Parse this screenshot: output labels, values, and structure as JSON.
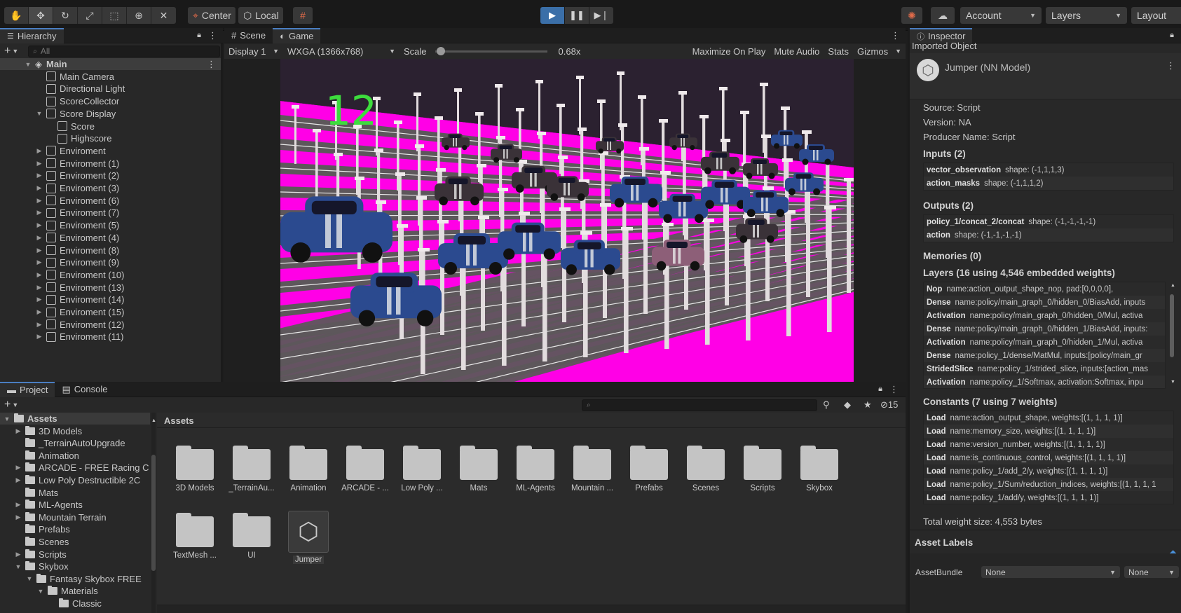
{
  "toolbar": {
    "pivot": "Center",
    "space": "Local",
    "account": "Account",
    "layers": "Layers",
    "layout": "Layout"
  },
  "hierarchy": {
    "tab": "Hierarchy",
    "search_placeholder": "All",
    "items": [
      {
        "label": "Main"
      },
      {
        "label": "Main Camera"
      },
      {
        "label": "Directional Light"
      },
      {
        "label": "ScoreCollector"
      },
      {
        "label": "Score Display"
      },
      {
        "label": "Score"
      },
      {
        "label": "Highscore"
      },
      {
        "label": "Enviroment"
      },
      {
        "label": "Enviroment (1)"
      },
      {
        "label": "Enviroment (2)"
      },
      {
        "label": "Enviroment (3)"
      },
      {
        "label": "Enviroment (6)"
      },
      {
        "label": "Enviroment (7)"
      },
      {
        "label": "Enviroment (5)"
      },
      {
        "label": "Enviroment (4)"
      },
      {
        "label": "Enviroment (8)"
      },
      {
        "label": "Enviroment (9)"
      },
      {
        "label": "Enviroment (10)"
      },
      {
        "label": "Enviroment (13)"
      },
      {
        "label": "Enviroment (14)"
      },
      {
        "label": "Enviroment (15)"
      },
      {
        "label": "Enviroment (12)"
      },
      {
        "label": "Enviroment (11)"
      }
    ]
  },
  "view_tabs": {
    "scene": "Scene",
    "game": "Game"
  },
  "game_toolbar": {
    "display": "Display 1",
    "resolution": "WXGA (1366x768)",
    "scale_label": "Scale",
    "scale_value": "0.68x",
    "scale_level": 0.05,
    "maximize": "Maximize On Play",
    "mute": "Mute Audio",
    "stats": "Stats",
    "gizmos": "Gizmos"
  },
  "game": {
    "score": "12"
  },
  "project": {
    "tab_project": "Project",
    "tab_console": "Console",
    "hidden_count": "15",
    "breadcrumb": "Assets",
    "tree": [
      {
        "label": "Assets"
      },
      {
        "label": "3D Models"
      },
      {
        "label": "_TerrainAutoUpgrade"
      },
      {
        "label": "Animation"
      },
      {
        "label": "ARCADE - FREE Racing C"
      },
      {
        "label": "Low Poly Destructible 2C"
      },
      {
        "label": "Mats"
      },
      {
        "label": "ML-Agents"
      },
      {
        "label": "Mountain Terrain"
      },
      {
        "label": "Prefabs"
      },
      {
        "label": "Scenes"
      },
      {
        "label": "Scripts"
      },
      {
        "label": "Skybox"
      },
      {
        "label": "Fantasy Skybox FREE"
      },
      {
        "label": "Materials"
      },
      {
        "label": "Classic"
      }
    ],
    "assets": [
      {
        "label": "3D Models"
      },
      {
        "label": "_TerrainAu..."
      },
      {
        "label": "Animation"
      },
      {
        "label": "ARCADE - ..."
      },
      {
        "label": "Low Poly ..."
      },
      {
        "label": "Mats"
      },
      {
        "label": "ML-Agents"
      },
      {
        "label": "Mountain ..."
      },
      {
        "label": "Prefabs"
      },
      {
        "label": "Scenes"
      },
      {
        "label": "Scripts"
      },
      {
        "label": "Skybox"
      },
      {
        "label": "TextMesh ..."
      },
      {
        "label": "UI"
      },
      {
        "label": "Jumper"
      }
    ]
  },
  "inspector": {
    "tab": "Inspector",
    "subtitle": "Imported Object",
    "object_name": "Jumper (NN Model)",
    "source": "Source: Script",
    "version": "Version: NA",
    "producer": "Producer Name: Script",
    "inputs_title": "Inputs (2)",
    "inputs": [
      {
        "name": "vector_observation",
        "detail": "shape: (-1,1,1,3)"
      },
      {
        "name": "action_masks",
        "detail": "shape: (-1,1,1,2)"
      }
    ],
    "outputs_title": "Outputs (2)",
    "outputs": [
      {
        "name": "policy_1/concat_2/concat",
        "detail": "shape: (-1,-1,-1,-1)"
      },
      {
        "name": "action",
        "detail": "shape: (-1,-1,-1,-1)"
      }
    ],
    "memories_title": "Memories (0)",
    "layers_title": "Layers (16 using 4,546 embedded weights)",
    "layers": [
      {
        "name": "Nop",
        "detail": "name:action_output_shape_nop, pad:[0,0,0,0],"
      },
      {
        "name": "Dense",
        "detail": "name:policy/main_graph_0/hidden_0/BiasAdd, inputs"
      },
      {
        "name": "Activation",
        "detail": "name:policy/main_graph_0/hidden_0/Mul, activa"
      },
      {
        "name": "Dense",
        "detail": "name:policy/main_graph_0/hidden_1/BiasAdd, inputs:"
      },
      {
        "name": "Activation",
        "detail": "name:policy/main_graph_0/hidden_1/Mul, activa"
      },
      {
        "name": "Dense",
        "detail": "name:policy_1/dense/MatMul, inputs:[policy/main_gr"
      },
      {
        "name": "StridedSlice",
        "detail": "name:policy_1/strided_slice, inputs:[action_mas"
      },
      {
        "name": "Activation",
        "detail": "name:policy_1/Softmax, activation:Softmax, inpu"
      }
    ],
    "constants_title": "Constants (7 using 7 weights)",
    "constants": [
      {
        "name": "Load",
        "detail": "name:action_output_shape, weights:[(1, 1, 1, 1)]"
      },
      {
        "name": "Load",
        "detail": "name:memory_size, weights:[(1, 1, 1, 1)]"
      },
      {
        "name": "Load",
        "detail": "name:version_number, weights:[(1, 1, 1, 1)]"
      },
      {
        "name": "Load",
        "detail": "name:is_continuous_control, weights:[(1, 1, 1, 1)]"
      },
      {
        "name": "Load",
        "detail": "name:policy_1/add_2/y, weights:[(1, 1, 1, 1)]"
      },
      {
        "name": "Load",
        "detail": "name:policy_1/Sum/reduction_indices, weights:[(1, 1, 1, 1"
      },
      {
        "name": "Load",
        "detail": "name:policy_1/add/y, weights:[(1, 1, 1, 1)]"
      }
    ],
    "total_weight": "Total weight size: 4,553 bytes",
    "asset_labels": "Asset Labels",
    "asset_bundle_label": "AssetBundle",
    "asset_bundle_value": "None",
    "asset_variant_value": "None"
  },
  "colors": {
    "accent": "#3b6fa8",
    "magenta": "#ff00e6",
    "score_green": "#3ddc3d",
    "road": "#5d575b"
  }
}
